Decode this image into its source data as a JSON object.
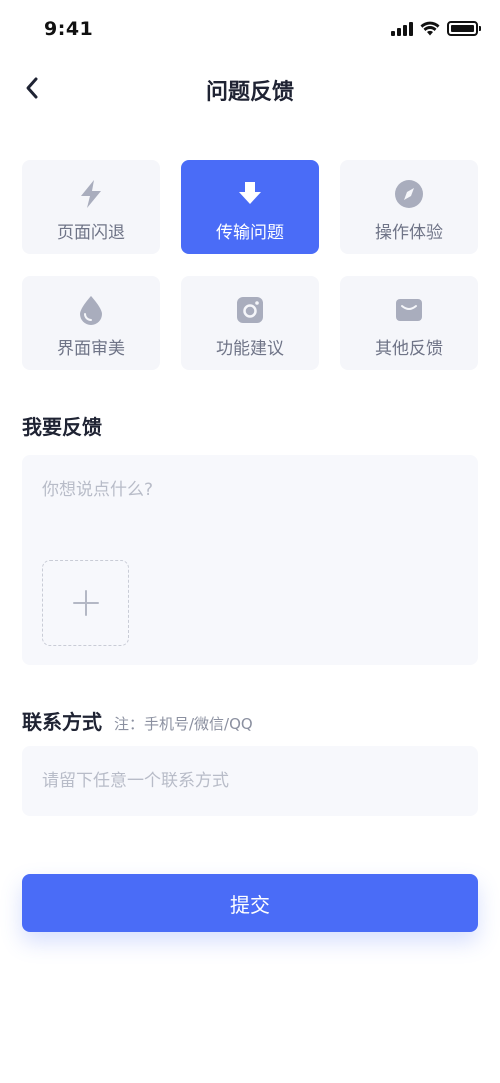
{
  "status_bar": {
    "time": "9:41",
    "icons": [
      "signal-icon",
      "wifi-icon",
      "battery-icon"
    ]
  },
  "nav": {
    "back_icon": "back-arrow-icon",
    "title": "问题反馈"
  },
  "categories": [
    {
      "label": "页面闪退",
      "icon": "lightning-icon",
      "active": false
    },
    {
      "label": "传输问题",
      "icon": "download-arrow-icon",
      "active": true
    },
    {
      "label": "操作体验",
      "icon": "compass-icon",
      "active": false
    },
    {
      "label": "界面审美",
      "icon": "droplet-icon",
      "active": false
    },
    {
      "label": "功能建议",
      "icon": "camera-icon",
      "active": false
    },
    {
      "label": "其他反馈",
      "icon": "mail-icon",
      "active": false
    }
  ],
  "feedback": {
    "title": "我要反馈",
    "placeholder": "你想说点什么?",
    "value": "",
    "upload_icon": "plus-icon"
  },
  "contact": {
    "title": "联系方式",
    "note": "注：手机号/微信/QQ",
    "placeholder": "请留下任意一个联系方式",
    "value": ""
  },
  "submit": {
    "label": "提交"
  },
  "colors": {
    "accent": "#4a6cf7",
    "tile_bg": "#f5f6fa",
    "icon_gray": "#a9adbd",
    "title_text": "#1f2333"
  }
}
